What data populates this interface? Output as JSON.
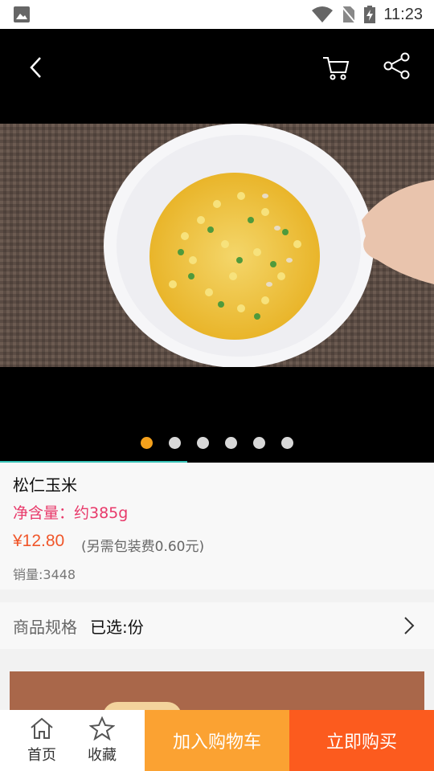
{
  "status_bar": {
    "time": "11:23"
  },
  "product": {
    "name": "松仁玉米",
    "net_weight": "净含量：约385g",
    "price": "¥12.80",
    "packaging_fee": "(另需包装费0.60元)",
    "sales": "销量:3448"
  },
  "carousel": {
    "total": 6,
    "active": 0
  },
  "spec": {
    "label": "商品规格",
    "value": "已选:份"
  },
  "bottom_bar": {
    "home_label": "首页",
    "favorite_label": "收藏",
    "add_to_cart_label": "加入购物车",
    "buy_now_label": "立即购买"
  },
  "colors": {
    "accent_orange": "#fba232",
    "buy_orange": "#fc5b1e",
    "price_color": "#f0562a",
    "net_color": "#e8396a",
    "dot_active": "#f5a11c"
  }
}
